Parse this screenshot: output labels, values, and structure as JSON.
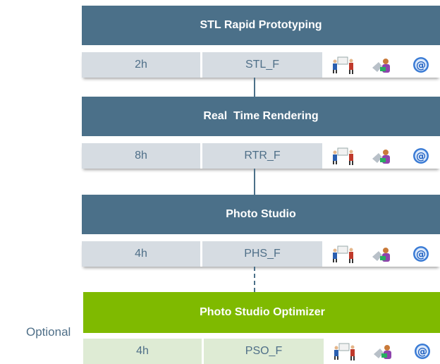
{
  "courses": [
    {
      "title": "STL Rapid Prototyping",
      "duration": "2h",
      "code": "STL_F"
    },
    {
      "title": "Real  Time Rendering",
      "duration": "8h",
      "code": "RTR_F"
    },
    {
      "title": "Photo Studio",
      "duration": "4h",
      "code": "PHS_F"
    },
    {
      "title": "Photo Studio Optimizer",
      "duration": "4h",
      "code": "PSO_F"
    }
  ],
  "optional_label": "Optional",
  "colors": {
    "main": "#4b7089",
    "optional": "#7fba00"
  },
  "icons": [
    "classroom-training-icon",
    "self-study-icon",
    "e-learning-icon"
  ]
}
